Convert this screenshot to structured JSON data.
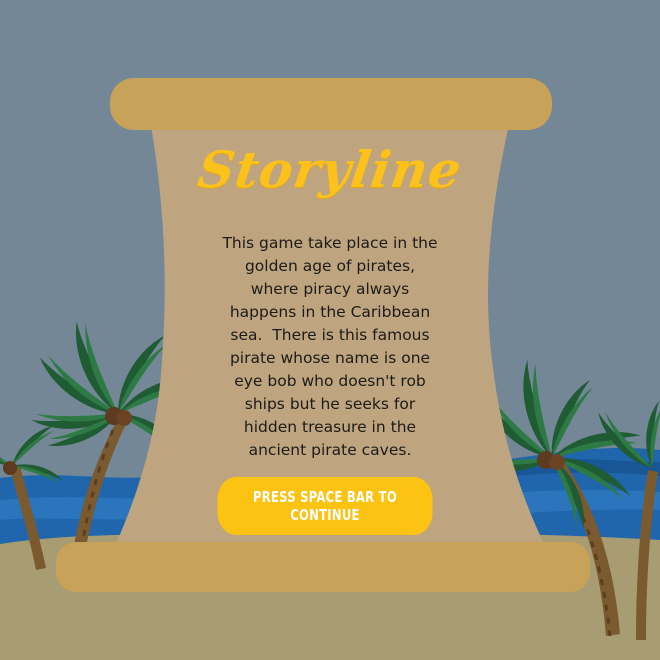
{
  "screen": {
    "title": "Storyline",
    "story_lines": [
      "This game take place in the",
      "golden age of pirates,",
      "where piracy always",
      "happens in the Caribbean",
      "sea.  There is this famous",
      "pirate whose name is one",
      "eye bob who doesn't rob",
      "ships but he seeks for",
      "hidden treasure in the",
      "ancient pirate caves."
    ],
    "continue_label": "PRESS SPACE BAR TO CONTINUE"
  },
  "colors": {
    "sky": "#738797",
    "sea": "#1f66ad",
    "sand": "#a89d72",
    "scroll": "#bfa57f",
    "scroll_roll": "#c9a25a",
    "accent": "#fcc21b"
  }
}
